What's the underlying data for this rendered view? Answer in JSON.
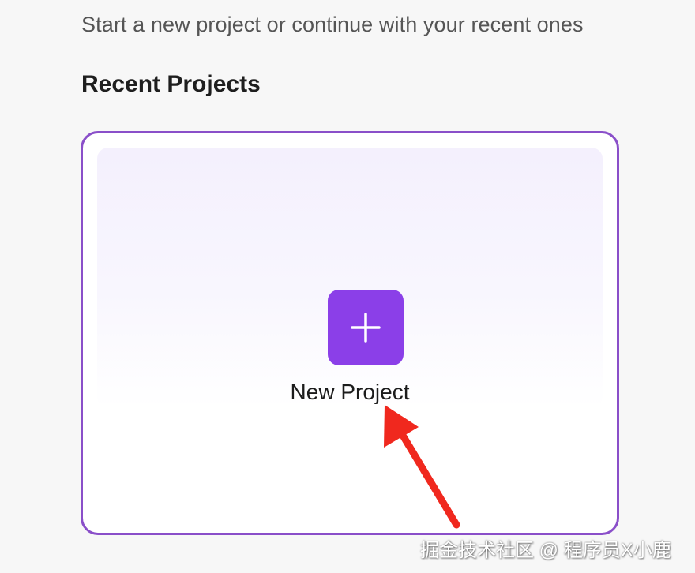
{
  "header": {
    "subtitle": "Start a new project or continue with your recent ones"
  },
  "recent": {
    "title": "Recent Projects",
    "new_project_card": {
      "label": "New Project",
      "icon": "plus-icon"
    }
  },
  "annotation": {
    "arrow_color": "#f0281e",
    "watermark": "掘金技术社区 @ 程序员X小鹿"
  },
  "colors": {
    "accent": "#8b3fe8",
    "card_border": "#8a4fc9",
    "background": "#f7f7f7"
  }
}
